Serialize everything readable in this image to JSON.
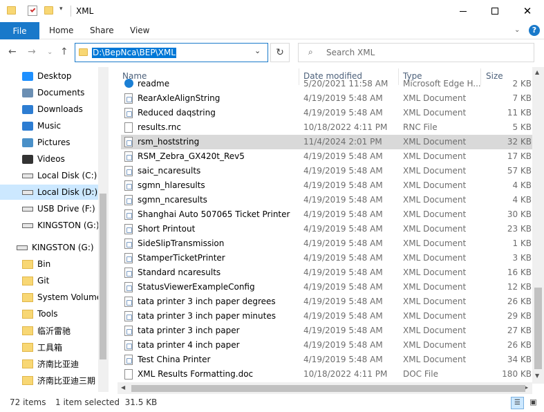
{
  "window": {
    "title": "XML"
  },
  "ribbon": {
    "tabs": [
      "File",
      "Home",
      "Share",
      "View"
    ]
  },
  "address": {
    "path": "D:\\BepNca\\BEP\\XML"
  },
  "search": {
    "placeholder": "Search XML"
  },
  "nav": [
    {
      "label": "Desktop",
      "icon": "desktop-icon",
      "color": "#1e90ff"
    },
    {
      "label": "Documents",
      "icon": "documents-icon",
      "color": "#6b8fb3"
    },
    {
      "label": "Downloads",
      "icon": "downloads-icon",
      "color": "#2d7dd2"
    },
    {
      "label": "Music",
      "icon": "music-icon",
      "color": "#2d7dd2"
    },
    {
      "label": "Pictures",
      "icon": "pictures-icon",
      "color": "#4a90c8"
    },
    {
      "label": "Videos",
      "icon": "videos-icon",
      "color": "#333333"
    },
    {
      "label": "Local Disk (C:)",
      "icon": "disk-icon",
      "color": "#666666"
    },
    {
      "label": "Local Disk (D:)",
      "icon": "disk-icon",
      "color": "#666666"
    },
    {
      "label": "USB Drive (F:)",
      "icon": "usb-drive-icon",
      "color": "#666666"
    },
    {
      "label": "KINGSTON (G:)",
      "icon": "usb-drive-icon",
      "color": "#666666"
    },
    {
      "label": "KINGSTON (G:)",
      "icon": "usb-drive-icon",
      "color": "#666666"
    },
    {
      "label": "Bin",
      "icon": "folder-icon",
      "color": "#f8d774"
    },
    {
      "label": "Git",
      "icon": "folder-icon",
      "color": "#f8d774"
    },
    {
      "label": "System Volume I",
      "icon": "folder-icon",
      "color": "#f8d774"
    },
    {
      "label": "Tools",
      "icon": "folder-icon",
      "color": "#f8d774"
    },
    {
      "label": "临沂雷驰",
      "icon": "folder-icon",
      "color": "#f8d774"
    },
    {
      "label": "工具箱",
      "icon": "folder-icon",
      "color": "#f8d774"
    },
    {
      "label": "济南比亚迪",
      "icon": "folder-icon",
      "color": "#f8d774"
    },
    {
      "label": "济南比亚迪三期",
      "icon": "folder-icon",
      "color": "#f8d774"
    }
  ],
  "columns": {
    "name": "Name",
    "date": "Date modified",
    "type": "Type",
    "size": "Size"
  },
  "files": [
    {
      "name": "readme",
      "date": "5/20/2021 11:58 AM",
      "type": "Microsoft Edge H...",
      "size": "2 KB",
      "icon": "edge-icon"
    },
    {
      "name": "RearAxleAlignString",
      "date": "4/19/2019 5:48 AM",
      "type": "XML Document",
      "size": "7 KB",
      "icon": "xml-icon"
    },
    {
      "name": "Reduced daqstring",
      "date": "4/19/2019 5:48 AM",
      "type": "XML Document",
      "size": "11 KB",
      "icon": "xml-icon"
    },
    {
      "name": "results.rnc",
      "date": "10/18/2022 4:11 PM",
      "type": "RNC File",
      "size": "5 KB",
      "icon": "file-icon"
    },
    {
      "name": "rsm_hoststring",
      "date": "11/4/2024 2:01 PM",
      "type": "XML Document",
      "size": "32 KB",
      "icon": "xml-icon",
      "selected": true
    },
    {
      "name": "RSM_Zebra_GX420t_Rev5",
      "date": "4/19/2019 5:48 AM",
      "type": "XML Document",
      "size": "17 KB",
      "icon": "xml-icon"
    },
    {
      "name": "saic_ncaresults",
      "date": "4/19/2019 5:48 AM",
      "type": "XML Document",
      "size": "57 KB",
      "icon": "xml-icon"
    },
    {
      "name": "sgmn_hlaresults",
      "date": "4/19/2019 5:48 AM",
      "type": "XML Document",
      "size": "4 KB",
      "icon": "xml-icon"
    },
    {
      "name": "sgmn_ncaresults",
      "date": "4/19/2019 5:48 AM",
      "type": "XML Document",
      "size": "4 KB",
      "icon": "xml-icon"
    },
    {
      "name": "Shanghai Auto 507065 Ticket Printer",
      "date": "4/19/2019 5:48 AM",
      "type": "XML Document",
      "size": "30 KB",
      "icon": "xml-icon"
    },
    {
      "name": "Short Printout",
      "date": "4/19/2019 5:48 AM",
      "type": "XML Document",
      "size": "23 KB",
      "icon": "xml-icon"
    },
    {
      "name": "SideSlipTransmission",
      "date": "4/19/2019 5:48 AM",
      "type": "XML Document",
      "size": "1 KB",
      "icon": "xml-icon"
    },
    {
      "name": "StamperTicketPrinter",
      "date": "4/19/2019 5:48 AM",
      "type": "XML Document",
      "size": "3 KB",
      "icon": "xml-icon"
    },
    {
      "name": "Standard ncaresults",
      "date": "4/19/2019 5:48 AM",
      "type": "XML Document",
      "size": "16 KB",
      "icon": "xml-icon"
    },
    {
      "name": "StatusViewerExampleConfig",
      "date": "4/19/2019 5:48 AM",
      "type": "XML Document",
      "size": "12 KB",
      "icon": "xml-icon"
    },
    {
      "name": "tata printer 3 inch paper degrees",
      "date": "4/19/2019 5:48 AM",
      "type": "XML Document",
      "size": "26 KB",
      "icon": "xml-icon"
    },
    {
      "name": "tata printer 3 inch paper minutes",
      "date": "4/19/2019 5:48 AM",
      "type": "XML Document",
      "size": "29 KB",
      "icon": "xml-icon"
    },
    {
      "name": "tata printer 3 inch paper",
      "date": "4/19/2019 5:48 AM",
      "type": "XML Document",
      "size": "27 KB",
      "icon": "xml-icon"
    },
    {
      "name": "tata printer 4 inch paper",
      "date": "4/19/2019 5:48 AM",
      "type": "XML Document",
      "size": "26 KB",
      "icon": "xml-icon"
    },
    {
      "name": "Test China Printer",
      "date": "4/19/2019 5:48 AM",
      "type": "XML Document",
      "size": "34 KB",
      "icon": "xml-icon"
    },
    {
      "name": "XML Results Formatting.doc",
      "date": "10/18/2022 4:11 PM",
      "type": "DOC File",
      "size": "180 KB",
      "icon": "file-icon"
    }
  ],
  "status": {
    "count": "72 items",
    "selection": "1 item selected  31.5 KB"
  },
  "colors": {
    "accent": "#1979ca",
    "selection": "#cce8ff",
    "row_selected": "#d9d9d9"
  }
}
